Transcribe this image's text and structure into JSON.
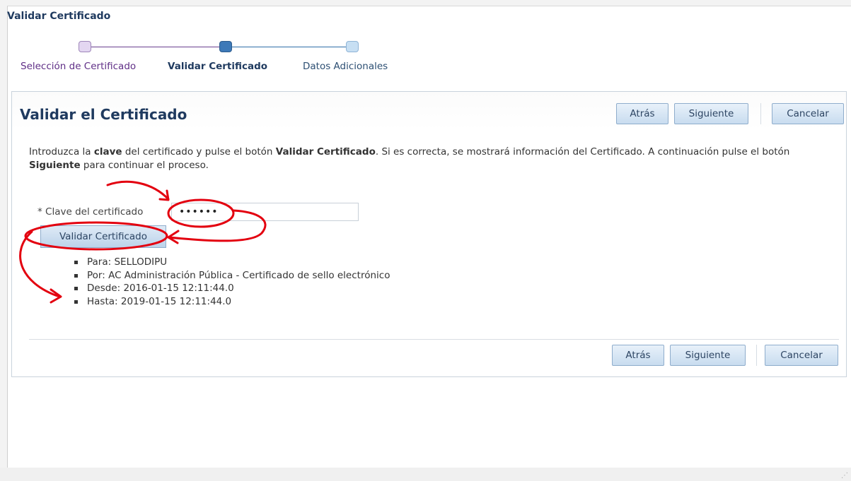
{
  "page_title": "Validar Certificado",
  "train": {
    "steps": [
      {
        "label": "Selección de Certificado",
        "state": "visited"
      },
      {
        "label": "Validar Certificado",
        "state": "current"
      },
      {
        "label": "Datos Adicionales",
        "state": "next"
      }
    ]
  },
  "panel": {
    "title": "Validar el Certificado",
    "buttons": {
      "back": "Atrás",
      "next": "Siguiente",
      "cancel": "Cancelar"
    }
  },
  "instructions": {
    "p1": "Introduzca la ",
    "b1": "clave",
    "p2": " del certificado y pulse el botón ",
    "b2": "Validar Certificado",
    "p3": ". Si es correcta, se mostrará información del Certificado. A continuación pulse el botón ",
    "b3": "Siguiente",
    "p4": " para continuar el proceso."
  },
  "password_field": {
    "label": "* Clave del certificado",
    "value": "••••••"
  },
  "validate_button": "Validar Certificado",
  "certificate_info": [
    "Para: SELLODIPU",
    "Por: AC Administración Pública - Certificado de sello electrónico",
    "Desde: 2016-01-15 12:11:44.0",
    "Hasta: 2019-01-15 12:11:44.0"
  ],
  "colors": {
    "accent": "#1f3a5f",
    "annotation": "#e3000f",
    "visited": "#5f2e86"
  },
  "icons": {
    "resize": "resize-grip-icon"
  }
}
